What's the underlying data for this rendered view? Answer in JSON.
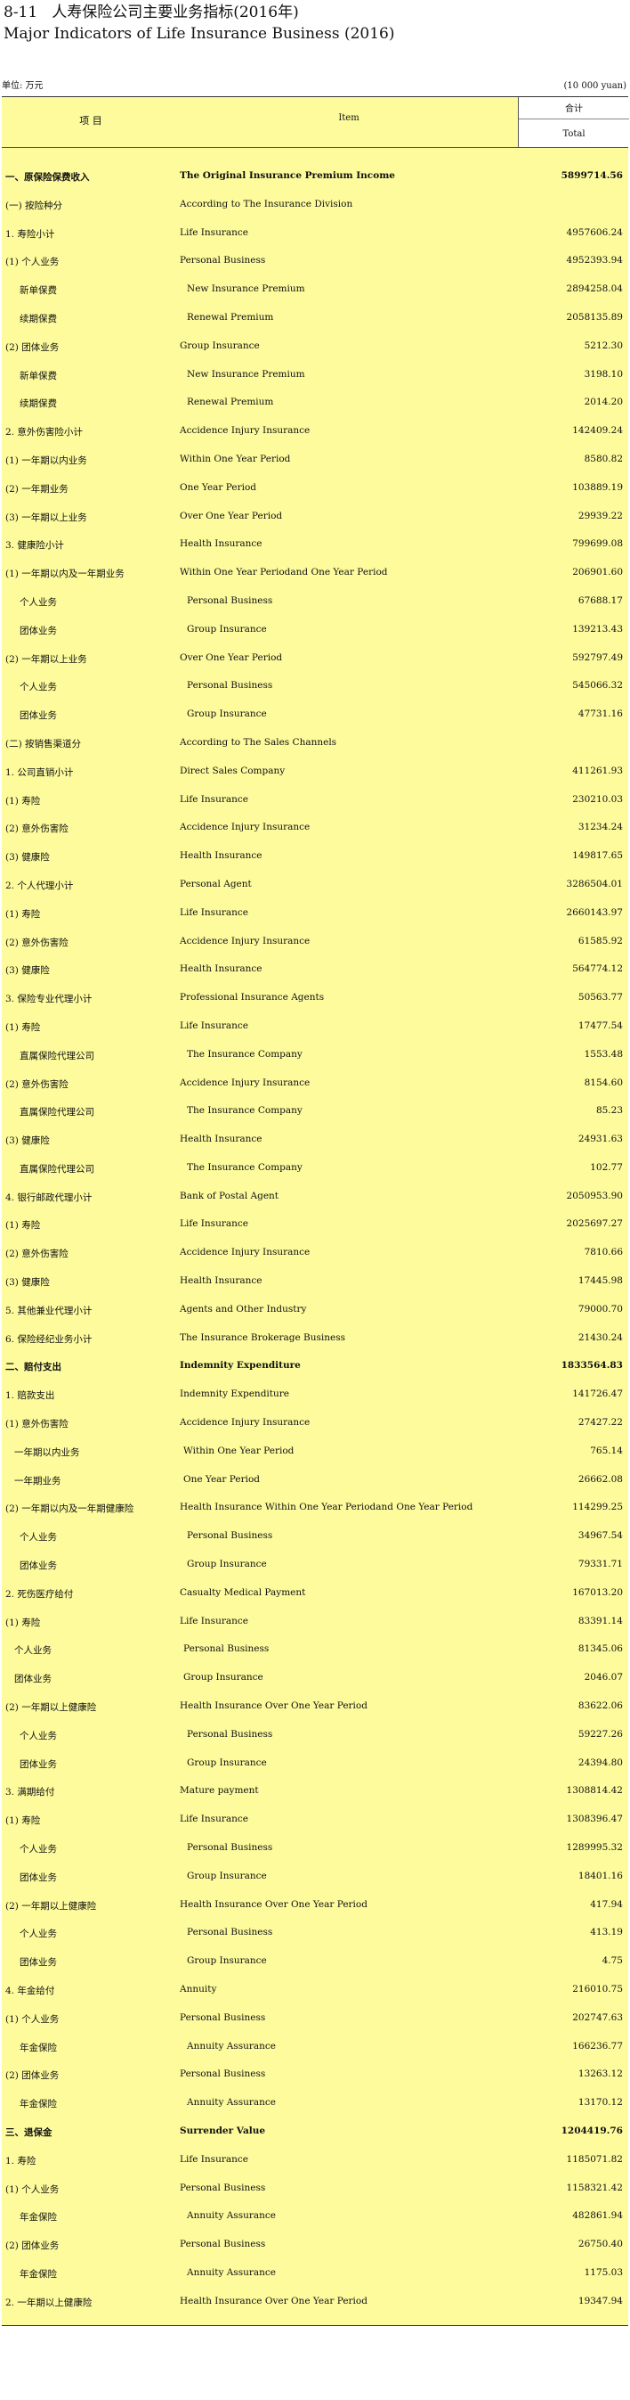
{
  "title": {
    "number": "8-11",
    "zh": "人寿保险公司主要业务指标(2016年)",
    "en": "Major Indicators of Life Insurance Business (2016)"
  },
  "unit": {
    "zh": "单位: 万元",
    "en": "(10 000 yuan)"
  },
  "header": {
    "item_zh": "项  目",
    "item_en": "Item",
    "total_zh": "合计",
    "total_en": "Total"
  },
  "rows": [
    {
      "zh": "一、原保险保费收入",
      "en": "The Original Insurance Premium Income",
      "value": "5899714.56",
      "style": "bold"
    },
    {
      "zh": "(一) 按险种分",
      "en": "According to The Insurance Division",
      "value": "",
      "style": ""
    },
    {
      "zh": "1. 寿险小计",
      "en": "Life Insurance",
      "value": "4957606.24",
      "style": ""
    },
    {
      "zh": "(1) 个人业务",
      "en": "Personal Business",
      "value": "4952393.94",
      "style": ""
    },
    {
      "zh": "新单保费",
      "en": "New Insurance Premium",
      "value": "2894258.04",
      "style": "ind2"
    },
    {
      "zh": "续期保费",
      "en": "Renewal Premium",
      "value": "2058135.89",
      "style": "ind2"
    },
    {
      "zh": "(2) 团体业务",
      "en": "Group Insurance",
      "value": "5212.30",
      "style": ""
    },
    {
      "zh": "新单保费",
      "en": "New Insurance Premium",
      "value": "3198.10",
      "style": "ind2"
    },
    {
      "zh": "续期保费",
      "en": "Renewal Premium",
      "value": "2014.20",
      "style": "ind2"
    },
    {
      "zh": "2. 意外伤害险小计",
      "en": "Accidence Injury Insurance",
      "value": "142409.24",
      "style": ""
    },
    {
      "zh": "(1) 一年期以内业务",
      "en": "Within One Year Period",
      "value": "8580.82",
      "style": ""
    },
    {
      "zh": "(2) 一年期业务",
      "en": "One Year Period",
      "value": "103889.19",
      "style": ""
    },
    {
      "zh": "(3) 一年期以上业务",
      "en": "Over One Year Period",
      "value": "29939.22",
      "style": ""
    },
    {
      "zh": "3. 健康险小计",
      "en": "Health Insurance",
      "value": "799699.08",
      "style": ""
    },
    {
      "zh": "(1) 一年期以内及一年期业务",
      "en": "Within One Year Periodand One Year Period",
      "value": "206901.60",
      "style": ""
    },
    {
      "zh": "个人业务",
      "en": "Personal Business",
      "value": "67688.17",
      "style": "ind2"
    },
    {
      "zh": "团体业务",
      "en": "Group Insurance",
      "value": "139213.43",
      "style": "ind2"
    },
    {
      "zh": "(2) 一年期以上业务",
      "en": "Over One Year Period",
      "value": "592797.49",
      "style": ""
    },
    {
      "zh": "个人业务",
      "en": "Personal Business",
      "value": "545066.32",
      "style": "ind2"
    },
    {
      "zh": "团体业务",
      "en": "Group Insurance",
      "value": "47731.16",
      "style": "ind2"
    },
    {
      "zh": "(二) 按销售渠道分",
      "en": "According to The Sales Channels",
      "value": "",
      "style": ""
    },
    {
      "zh": "1. 公司直销小计",
      "en": "Direct Sales Company",
      "value": "411261.93",
      "style": ""
    },
    {
      "zh": "(1) 寿险",
      "en": "Life Insurance",
      "value": "230210.03",
      "style": ""
    },
    {
      "zh": "(2) 意外伤害险",
      "en": "Accidence Injury Insurance",
      "value": "31234.24",
      "style": ""
    },
    {
      "zh": "(3) 健康险",
      "en": "Health Insurance",
      "value": "149817.65",
      "style": ""
    },
    {
      "zh": "2. 个人代理小计",
      "en": "Personal Agent",
      "value": "3286504.01",
      "style": ""
    },
    {
      "zh": "(1) 寿险",
      "en": "Life Insurance",
      "value": "2660143.97",
      "style": ""
    },
    {
      "zh": "(2) 意外伤害险",
      "en": "Accidence Injury Insurance",
      "value": "61585.92",
      "style": ""
    },
    {
      "zh": "(3) 健康险",
      "en": "Health Insurance",
      "value": "564774.12",
      "style": ""
    },
    {
      "zh": "3. 保险专业代理小计",
      "en": "Professional Insurance Agents",
      "value": "50563.77",
      "style": ""
    },
    {
      "zh": "(1) 寿险",
      "en": "Life Insurance",
      "value": "17477.54",
      "style": ""
    },
    {
      "zh": "直属保险代理公司",
      "en": "The Insurance Company",
      "value": "1553.48",
      "style": "ind2"
    },
    {
      "zh": "(2) 意外伤害险",
      "en": "Accidence Injury Insurance",
      "value": "8154.60",
      "style": ""
    },
    {
      "zh": "直属保险代理公司",
      "en": "The Insurance Company",
      "value": "85.23",
      "style": "ind2"
    },
    {
      "zh": "(3) 健康险",
      "en": "Health Insurance",
      "value": "24931.63",
      "style": ""
    },
    {
      "zh": "直属保险代理公司",
      "en": "The Insurance Company",
      "value": "102.77",
      "style": "ind2"
    },
    {
      "zh": "4. 银行邮政代理小计",
      "en": "Bank of Postal Agent",
      "value": "2050953.90",
      "style": ""
    },
    {
      "zh": "(1) 寿险",
      "en": "Life Insurance",
      "value": "2025697.27",
      "style": ""
    },
    {
      "zh": "(2) 意外伤害险",
      "en": "Accidence  Injury Insurance",
      "value": "7810.66",
      "style": ""
    },
    {
      "zh": "(3) 健康险",
      "en": "Health Insurance",
      "value": "17445.98",
      "style": ""
    },
    {
      "zh": "5. 其他兼业代理小计",
      "en": "Agents and Other Industry",
      "value": "79000.70",
      "style": ""
    },
    {
      "zh": "6. 保险经纪业务小计",
      "en": "The Insurance Brokerage Business",
      "value": "21430.24",
      "style": ""
    },
    {
      "zh": "二、赔付支出",
      "en": "Indemnity Expenditure",
      "value": "1833564.83",
      "style": "bold"
    },
    {
      "zh": "1. 赔款支出",
      "en": "Indemnity Expenditure",
      "value": "141726.47",
      "style": ""
    },
    {
      "zh": "(1) 意外伤害险",
      "en": "Accidence  Injury Insurance",
      "value": "27427.22",
      "style": ""
    },
    {
      "zh": "一年期以内业务",
      "en": "Within One Year Period",
      "value": "765.14",
      "style": "ind1"
    },
    {
      "zh": "一年期业务",
      "en": "One Year Period",
      "value": "26662.08",
      "style": "ind1"
    },
    {
      "zh": "(2) 一年期以内及一年期健康险",
      "en": "Health Insurance  Within One Year Periodand One Year Period",
      "value": "114299.25",
      "style": ""
    },
    {
      "zh": "个人业务",
      "en": "Personal Business",
      "value": "34967.54",
      "style": "ind2"
    },
    {
      "zh": "团体业务",
      "en": "Group Insurance",
      "value": "79331.71",
      "style": "ind2"
    },
    {
      "zh": "2. 死伤医疗给付",
      "en": "Casualty Medical Payment",
      "value": "167013.20",
      "style": ""
    },
    {
      "zh": "(1) 寿险",
      "en": "Life Insurance",
      "value": "83391.14",
      "style": ""
    },
    {
      "zh": "个人业务",
      "en": "Personal Business",
      "value": "81345.06",
      "style": "ind1"
    },
    {
      "zh": "团体业务",
      "en": "Group Insurance",
      "value": "2046.07",
      "style": "ind1"
    },
    {
      "zh": "(2) 一年期以上健康险",
      "en": "Health Insurance Over One Year Period",
      "value": "83622.06",
      "style": ""
    },
    {
      "zh": "个人业务",
      "en": "Personal Business",
      "value": "59227.26",
      "style": "ind2"
    },
    {
      "zh": "团体业务",
      "en": "Group Insurance",
      "value": "24394.80",
      "style": "ind2"
    },
    {
      "zh": "3. 满期给付",
      "en": "Mature payment",
      "value": "1308814.42",
      "style": ""
    },
    {
      "zh": "(1) 寿险",
      "en": "Life Insurance",
      "value": "1308396.47",
      "style": ""
    },
    {
      "zh": "个人业务",
      "en": "Personal Business",
      "value": "1289995.32",
      "style": "ind2"
    },
    {
      "zh": "团体业务",
      "en": "Group Insurance",
      "value": "18401.16",
      "style": "ind2"
    },
    {
      "zh": "(2) 一年期以上健康险",
      "en": "Health Insurance Over One Year Period",
      "value": "417.94",
      "style": ""
    },
    {
      "zh": "个人业务",
      "en": "Personal Business",
      "value": "413.19",
      "style": "ind2"
    },
    {
      "zh": "团体业务",
      "en": "Group Insurance",
      "value": "4.75",
      "style": "ind2"
    },
    {
      "zh": "4. 年金给付",
      "en": "Annuity",
      "value": "216010.75",
      "style": ""
    },
    {
      "zh": "(1) 个人业务",
      "en": "Personal Business",
      "value": "202747.63",
      "style": ""
    },
    {
      "zh": "年金保险",
      "en": "Annuity Assurance",
      "value": "166236.77",
      "style": "ind2"
    },
    {
      "zh": "(2) 团体业务",
      "en": "Personal Business",
      "value": "13263.12",
      "style": ""
    },
    {
      "zh": "年金保险",
      "en": "Annuity Assurance",
      "value": "13170.12",
      "style": "ind2"
    },
    {
      "zh": "三、退保金",
      "en": "Surrender Value",
      "value": "1204419.76",
      "style": "bold"
    },
    {
      "zh": "1. 寿险",
      "en": "Life Insurance",
      "value": "1185071.82",
      "style": ""
    },
    {
      "zh": "(1) 个人业务",
      "en": "Personal Business",
      "value": "1158321.42",
      "style": ""
    },
    {
      "zh": "年金保险",
      "en": "Annuity Assurance",
      "value": "482861.94",
      "style": "ind2"
    },
    {
      "zh": "(2) 团体业务",
      "en": "Personal Business",
      "value": "26750.40",
      "style": ""
    },
    {
      "zh": "年金保险",
      "en": "Annuity Assurance",
      "value": "1175.03",
      "style": "ind2"
    },
    {
      "zh": "2. 一年期以上健康险",
      "en": "Health Insurance Over One Year Period",
      "value": "19347.94",
      "style": ""
    }
  ]
}
